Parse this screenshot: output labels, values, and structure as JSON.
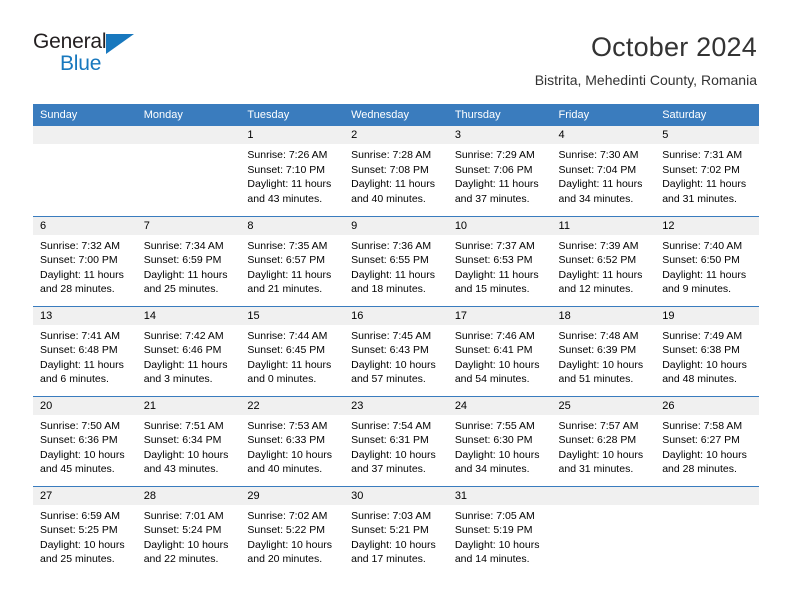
{
  "logo": {
    "word_top": "General",
    "word_bottom": "Blue",
    "triangle_color": "#1878be",
    "text_color": "#231f20"
  },
  "header": {
    "title": "October 2024",
    "subtitle": "Bistrita, Mehedinti County, Romania"
  },
  "theme": {
    "header_blue": "#3a7cbe",
    "daynum_bg": "#f0f0f0",
    "text": "#000000"
  },
  "weekdays": [
    "Sunday",
    "Monday",
    "Tuesday",
    "Wednesday",
    "Thursday",
    "Friday",
    "Saturday"
  ],
  "labels": {
    "sunrise": "Sunrise:",
    "sunset": "Sunset:",
    "daylight": "Daylight:"
  },
  "weeks": [
    [
      {
        "day": "",
        "sunrise": "",
        "sunset": "",
        "daylight_1": "",
        "daylight_2": ""
      },
      {
        "day": "",
        "sunrise": "",
        "sunset": "",
        "daylight_1": "",
        "daylight_2": ""
      },
      {
        "day": "1",
        "sunrise": "Sunrise: 7:26 AM",
        "sunset": "Sunset: 7:10 PM",
        "daylight_1": "Daylight: 11 hours",
        "daylight_2": "and 43 minutes."
      },
      {
        "day": "2",
        "sunrise": "Sunrise: 7:28 AM",
        "sunset": "Sunset: 7:08 PM",
        "daylight_1": "Daylight: 11 hours",
        "daylight_2": "and 40 minutes."
      },
      {
        "day": "3",
        "sunrise": "Sunrise: 7:29 AM",
        "sunset": "Sunset: 7:06 PM",
        "daylight_1": "Daylight: 11 hours",
        "daylight_2": "and 37 minutes."
      },
      {
        "day": "4",
        "sunrise": "Sunrise: 7:30 AM",
        "sunset": "Sunset: 7:04 PM",
        "daylight_1": "Daylight: 11 hours",
        "daylight_2": "and 34 minutes."
      },
      {
        "day": "5",
        "sunrise": "Sunrise: 7:31 AM",
        "sunset": "Sunset: 7:02 PM",
        "daylight_1": "Daylight: 11 hours",
        "daylight_2": "and 31 minutes."
      }
    ],
    [
      {
        "day": "6",
        "sunrise": "Sunrise: 7:32 AM",
        "sunset": "Sunset: 7:00 PM",
        "daylight_1": "Daylight: 11 hours",
        "daylight_2": "and 28 minutes."
      },
      {
        "day": "7",
        "sunrise": "Sunrise: 7:34 AM",
        "sunset": "Sunset: 6:59 PM",
        "daylight_1": "Daylight: 11 hours",
        "daylight_2": "and 25 minutes."
      },
      {
        "day": "8",
        "sunrise": "Sunrise: 7:35 AM",
        "sunset": "Sunset: 6:57 PM",
        "daylight_1": "Daylight: 11 hours",
        "daylight_2": "and 21 minutes."
      },
      {
        "day": "9",
        "sunrise": "Sunrise: 7:36 AM",
        "sunset": "Sunset: 6:55 PM",
        "daylight_1": "Daylight: 11 hours",
        "daylight_2": "and 18 minutes."
      },
      {
        "day": "10",
        "sunrise": "Sunrise: 7:37 AM",
        "sunset": "Sunset: 6:53 PM",
        "daylight_1": "Daylight: 11 hours",
        "daylight_2": "and 15 minutes."
      },
      {
        "day": "11",
        "sunrise": "Sunrise: 7:39 AM",
        "sunset": "Sunset: 6:52 PM",
        "daylight_1": "Daylight: 11 hours",
        "daylight_2": "and 12 minutes."
      },
      {
        "day": "12",
        "sunrise": "Sunrise: 7:40 AM",
        "sunset": "Sunset: 6:50 PM",
        "daylight_1": "Daylight: 11 hours",
        "daylight_2": "and 9 minutes."
      }
    ],
    [
      {
        "day": "13",
        "sunrise": "Sunrise: 7:41 AM",
        "sunset": "Sunset: 6:48 PM",
        "daylight_1": "Daylight: 11 hours",
        "daylight_2": "and 6 minutes."
      },
      {
        "day": "14",
        "sunrise": "Sunrise: 7:42 AM",
        "sunset": "Sunset: 6:46 PM",
        "daylight_1": "Daylight: 11 hours",
        "daylight_2": "and 3 minutes."
      },
      {
        "day": "15",
        "sunrise": "Sunrise: 7:44 AM",
        "sunset": "Sunset: 6:45 PM",
        "daylight_1": "Daylight: 11 hours",
        "daylight_2": "and 0 minutes."
      },
      {
        "day": "16",
        "sunrise": "Sunrise: 7:45 AM",
        "sunset": "Sunset: 6:43 PM",
        "daylight_1": "Daylight: 10 hours",
        "daylight_2": "and 57 minutes."
      },
      {
        "day": "17",
        "sunrise": "Sunrise: 7:46 AM",
        "sunset": "Sunset: 6:41 PM",
        "daylight_1": "Daylight: 10 hours",
        "daylight_2": "and 54 minutes."
      },
      {
        "day": "18",
        "sunrise": "Sunrise: 7:48 AM",
        "sunset": "Sunset: 6:39 PM",
        "daylight_1": "Daylight: 10 hours",
        "daylight_2": "and 51 minutes."
      },
      {
        "day": "19",
        "sunrise": "Sunrise: 7:49 AM",
        "sunset": "Sunset: 6:38 PM",
        "daylight_1": "Daylight: 10 hours",
        "daylight_2": "and 48 minutes."
      }
    ],
    [
      {
        "day": "20",
        "sunrise": "Sunrise: 7:50 AM",
        "sunset": "Sunset: 6:36 PM",
        "daylight_1": "Daylight: 10 hours",
        "daylight_2": "and 45 minutes."
      },
      {
        "day": "21",
        "sunrise": "Sunrise: 7:51 AM",
        "sunset": "Sunset: 6:34 PM",
        "daylight_1": "Daylight: 10 hours",
        "daylight_2": "and 43 minutes."
      },
      {
        "day": "22",
        "sunrise": "Sunrise: 7:53 AM",
        "sunset": "Sunset: 6:33 PM",
        "daylight_1": "Daylight: 10 hours",
        "daylight_2": "and 40 minutes."
      },
      {
        "day": "23",
        "sunrise": "Sunrise: 7:54 AM",
        "sunset": "Sunset: 6:31 PM",
        "daylight_1": "Daylight: 10 hours",
        "daylight_2": "and 37 minutes."
      },
      {
        "day": "24",
        "sunrise": "Sunrise: 7:55 AM",
        "sunset": "Sunset: 6:30 PM",
        "daylight_1": "Daylight: 10 hours",
        "daylight_2": "and 34 minutes."
      },
      {
        "day": "25",
        "sunrise": "Sunrise: 7:57 AM",
        "sunset": "Sunset: 6:28 PM",
        "daylight_1": "Daylight: 10 hours",
        "daylight_2": "and 31 minutes."
      },
      {
        "day": "26",
        "sunrise": "Sunrise: 7:58 AM",
        "sunset": "Sunset: 6:27 PM",
        "daylight_1": "Daylight: 10 hours",
        "daylight_2": "and 28 minutes."
      }
    ],
    [
      {
        "day": "27",
        "sunrise": "Sunrise: 6:59 AM",
        "sunset": "Sunset: 5:25 PM",
        "daylight_1": "Daylight: 10 hours",
        "daylight_2": "and 25 minutes."
      },
      {
        "day": "28",
        "sunrise": "Sunrise: 7:01 AM",
        "sunset": "Sunset: 5:24 PM",
        "daylight_1": "Daylight: 10 hours",
        "daylight_2": "and 22 minutes."
      },
      {
        "day": "29",
        "sunrise": "Sunrise: 7:02 AM",
        "sunset": "Sunset: 5:22 PM",
        "daylight_1": "Daylight: 10 hours",
        "daylight_2": "and 20 minutes."
      },
      {
        "day": "30",
        "sunrise": "Sunrise: 7:03 AM",
        "sunset": "Sunset: 5:21 PM",
        "daylight_1": "Daylight: 10 hours",
        "daylight_2": "and 17 minutes."
      },
      {
        "day": "31",
        "sunrise": "Sunrise: 7:05 AM",
        "sunset": "Sunset: 5:19 PM",
        "daylight_1": "Daylight: 10 hours",
        "daylight_2": "and 14 minutes."
      },
      {
        "day": "",
        "sunrise": "",
        "sunset": "",
        "daylight_1": "",
        "daylight_2": ""
      },
      {
        "day": "",
        "sunrise": "",
        "sunset": "",
        "daylight_1": "",
        "daylight_2": ""
      }
    ]
  ]
}
